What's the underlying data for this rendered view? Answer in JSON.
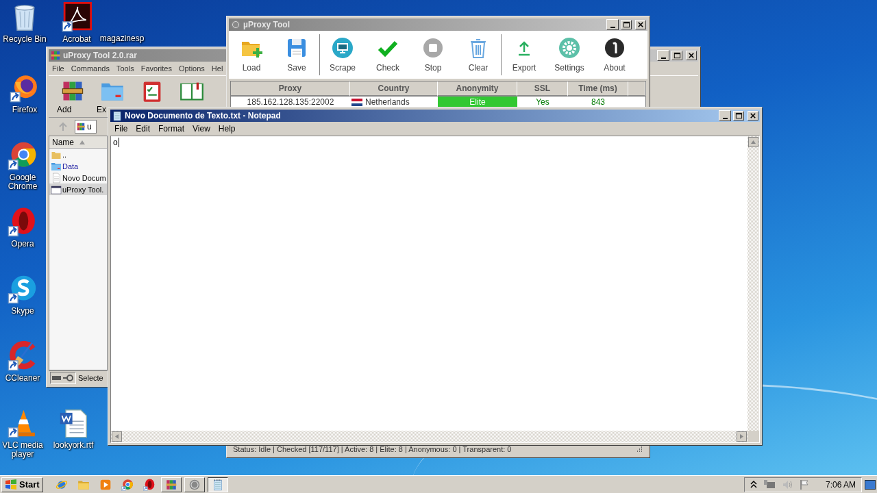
{
  "desktop_icons": [
    {
      "label": "Recycle Bin",
      "kind": "recycle"
    },
    {
      "label": "Acrobat",
      "kind": "acrobat"
    },
    {
      "label": "magazinesp",
      "kind": "blank"
    },
    {
      "label": "Firefox",
      "kind": "firefox"
    },
    {
      "label": "Google Chrome",
      "kind": "chrome"
    },
    {
      "label": "Opera",
      "kind": "opera"
    },
    {
      "label": "Skype",
      "kind": "skype"
    },
    {
      "label": "CCleaner",
      "kind": "ccleaner"
    },
    {
      "label": "VLC media player",
      "kind": "vlc"
    },
    {
      "label": "lookyork.rtf",
      "kind": "word"
    }
  ],
  "winrar_window": {
    "title": "uProxy Tool 2.0.rar",
    "active": false,
    "menu": [
      "File",
      "Commands",
      "Tools",
      "Favorites",
      "Options",
      "Hel"
    ],
    "toolbar": [
      {
        "label": "Add",
        "kind": "archive"
      },
      {
        "label": "Ex",
        "kind": "folder"
      },
      {
        "kind": "checklist"
      },
      {
        "kind": "book"
      }
    ],
    "address": "u",
    "list_header": "Name",
    "files": [
      {
        "name": "..",
        "kind": "parent",
        "selected": false
      },
      {
        "name": "Data",
        "kind": "folder",
        "selected": false
      },
      {
        "name": "Novo Docum",
        "kind": "text",
        "selected": false
      },
      {
        "name": "uProxy Tool.",
        "kind": "program",
        "selected": true
      }
    ],
    "status": "Selecte"
  },
  "uproxy_window": {
    "title": "µProxy Tool",
    "active": false,
    "toolbar": [
      [
        {
          "label": "Load",
          "kind": "load"
        },
        {
          "label": "Save",
          "kind": "save"
        }
      ],
      [
        {
          "label": "Scrape",
          "kind": "scrape"
        },
        {
          "label": "Check",
          "kind": "check"
        },
        {
          "label": "Stop",
          "kind": "stop"
        },
        {
          "label": "Clear",
          "kind": "clear"
        }
      ],
      [
        {
          "label": "Export",
          "kind": "export"
        },
        {
          "label": "Settings",
          "kind": "settings"
        },
        {
          "label": "About",
          "kind": "about"
        }
      ]
    ],
    "columns": [
      "Proxy",
      "Country",
      "Anonymity",
      "SSL",
      "Time (ms)"
    ],
    "rows": [
      {
        "proxy": "185.162.128.135:22002",
        "country": "Netherlands",
        "anonymity": "Elite",
        "ssl": "Yes",
        "time": "843"
      }
    ],
    "status": "Status: Idle | Checked [117/117] | Active: 8 | Elite: 8 | Anonymous: 0 | Transparent: 0"
  },
  "notepad_window": {
    "title": "Novo Documento de Texto.txt - Notepad",
    "active": true,
    "menu": [
      "File",
      "Edit",
      "Format",
      "View",
      "Help"
    ],
    "text": "o"
  },
  "taskbar": {
    "start": "Start",
    "quick_launch": [
      {
        "kind": "ie"
      },
      {
        "kind": "explorer"
      },
      {
        "kind": "media"
      },
      {
        "kind": "chrome"
      },
      {
        "kind": "opera"
      }
    ],
    "tasks": [
      {
        "kind": "winrar",
        "selected": false
      },
      {
        "kind": "uproxy",
        "selected": false
      },
      {
        "kind": "notepad",
        "selected": true
      }
    ],
    "clock": "7:06 AM"
  }
}
